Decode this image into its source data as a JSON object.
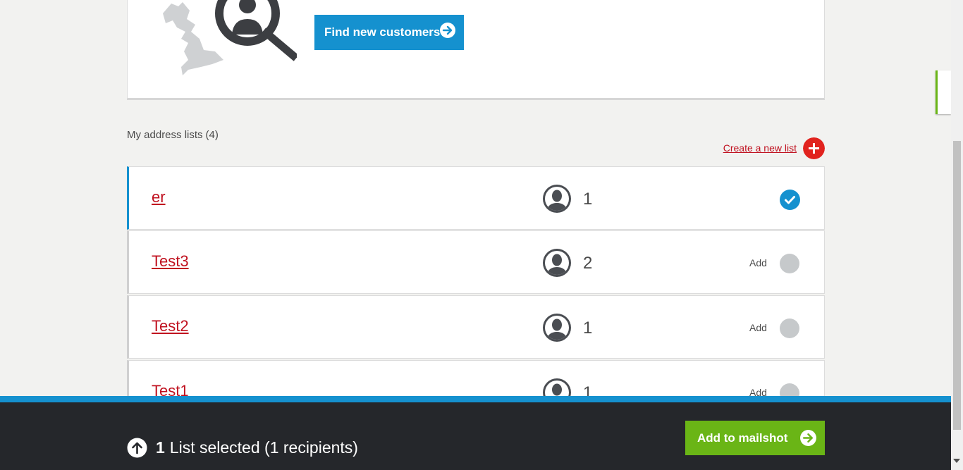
{
  "promo": {
    "find_button": "Find new customers",
    "illustration_icon": "uk-map-search-icon"
  },
  "lists": {
    "title": "My address lists",
    "count": "(4)",
    "create_link": "Create a new list",
    "items": [
      {
        "name": "er",
        "recipients": "1",
        "selected": true,
        "add_label": ""
      },
      {
        "name": "Test3",
        "recipients": "2",
        "selected": false,
        "add_label": "Add"
      },
      {
        "name": "Test2",
        "recipients": "1",
        "selected": false,
        "add_label": "Add"
      },
      {
        "name": "Test1",
        "recipients": "1",
        "selected": false,
        "add_label": "Add"
      }
    ]
  },
  "footer": {
    "selected_count": "1",
    "selected_text": "List selected (1 recipients)",
    "add_button": "Add to mailshot"
  },
  "colors": {
    "primary_blue": "#1591cf",
    "link_red": "#c0111f",
    "accent_green": "#6ab516",
    "footer_dark": "#25272b"
  }
}
